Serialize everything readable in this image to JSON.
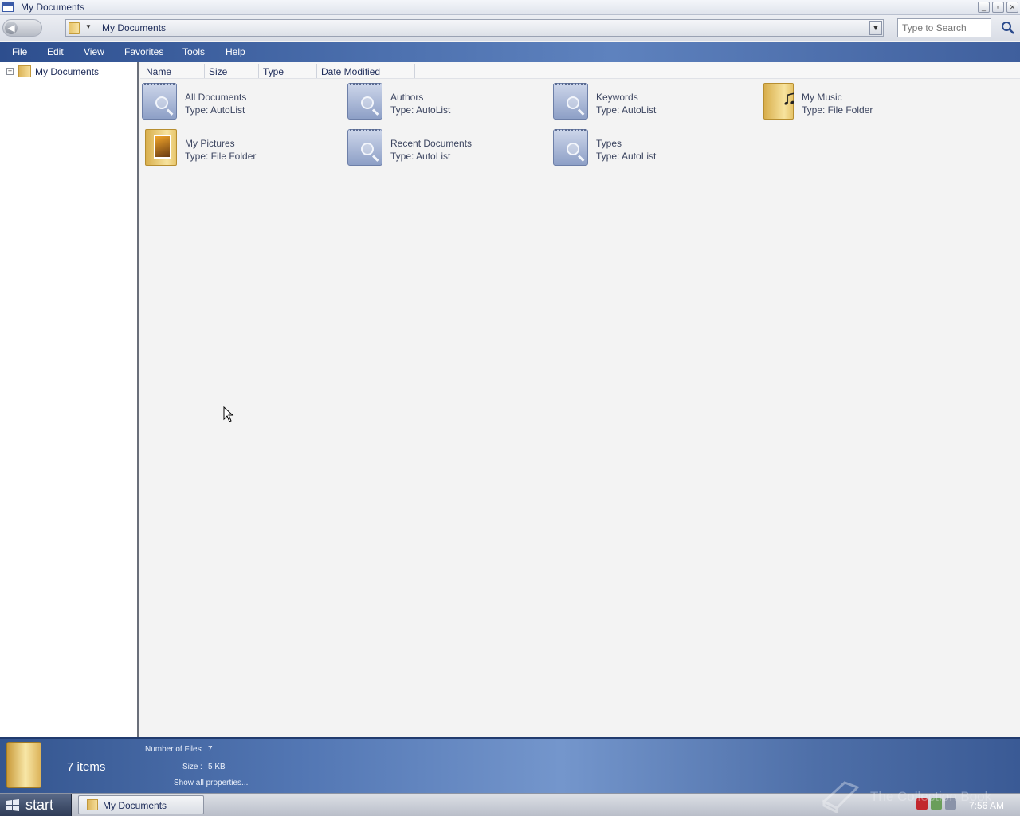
{
  "window": {
    "title": "My Documents",
    "controls": [
      "minimize",
      "restore",
      "close"
    ]
  },
  "address": {
    "path": "My Documents",
    "search_placeholder": "Type to Search"
  },
  "menu": {
    "items": [
      "File",
      "Edit",
      "View",
      "Favorites",
      "Tools",
      "Help"
    ]
  },
  "tree": {
    "root_label": "My Documents",
    "expander": "+"
  },
  "columns": [
    "Name",
    "Size",
    "Type",
    "Date Modified"
  ],
  "files": [
    {
      "name": "All Documents",
      "type": "Type: AutoList",
      "icon": "autolist-icon"
    },
    {
      "name": "Authors",
      "type": "Type: AutoList",
      "icon": "autolist-icon"
    },
    {
      "name": "Keywords",
      "type": "Type: AutoList",
      "icon": "autolist-icon"
    },
    {
      "name": "My Music",
      "type": "Type: File Folder",
      "icon": "music-folder-icon"
    },
    {
      "name": "My Pictures",
      "type": "Type: File Folder",
      "icon": "pictures-folder-icon"
    },
    {
      "name": "Recent Documents",
      "type": "Type: AutoList",
      "icon": "autolist-icon"
    },
    {
      "name": "Types",
      "type": "Type: AutoList",
      "icon": "autolist-icon"
    }
  ],
  "details": {
    "item_count": "7 items",
    "number_of_files_label": "Number of Files",
    "number_of_files_value": "7",
    "size_label": "Size",
    "size_value": "5 KB",
    "separator": ":",
    "show_all": "Show all properties..."
  },
  "taskbar": {
    "start_label": "start",
    "task_label": "My Documents",
    "clock": "7:56 AM",
    "watermark": "The Collection Book"
  }
}
